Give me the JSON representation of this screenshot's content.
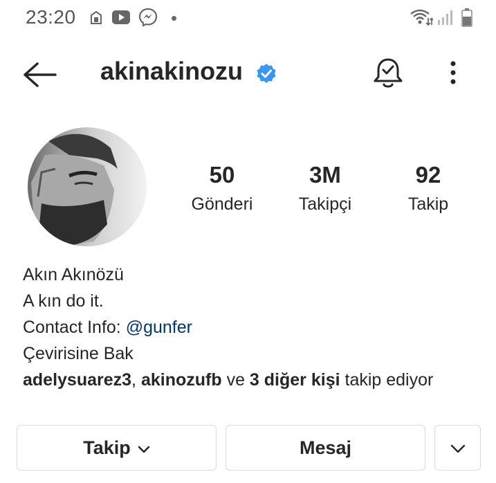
{
  "status_bar": {
    "time": "23:20",
    "icons": [
      "app-notification-icon",
      "youtube-icon",
      "messenger-icon",
      "wifi-icon",
      "signal-icon",
      "battery-icon"
    ]
  },
  "header": {
    "username": "akinakinozu",
    "verified": true,
    "icons": [
      "back-arrow-icon",
      "verified-badge-icon",
      "notification-bell-icon",
      "more-options-icon"
    ]
  },
  "stats": [
    {
      "value": "50",
      "label": "Gönderi"
    },
    {
      "value": "3M",
      "label": "Takipçi"
    },
    {
      "value": "92",
      "label": "Takip"
    }
  ],
  "bio": {
    "name": "Akın Akınözü",
    "description": "A kın do it.",
    "contact_prefix": "Contact Info: ",
    "contact_link": "@gunfer",
    "translate": "Çevirisine Bak",
    "followed_by": {
      "user1": "adelysuarez3",
      "separator": ", ",
      "user2": "akinozufb",
      "connector": " ve ",
      "others": "3 diğer kişi",
      "suffix": " takip ediyor"
    }
  },
  "actions": {
    "follow_label": "Takip",
    "message_label": "Mesaj"
  },
  "colors": {
    "verified": "#3897f0",
    "link": "#00376b",
    "border": "#dbdbdb"
  }
}
